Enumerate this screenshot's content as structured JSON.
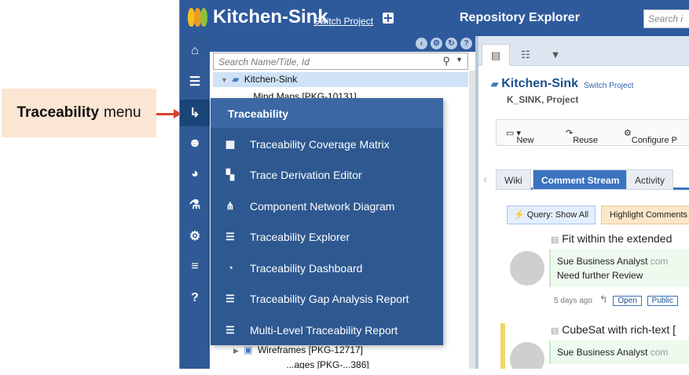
{
  "callout": {
    "bold": "Traceability",
    "text": "menu"
  },
  "topbar": {
    "project": "Kitchen-Sink",
    "switch_project": "Switch Project",
    "page_title": "Repository Explorer",
    "search_placeholder": "Search i"
  },
  "sidebar": {
    "items": [
      {
        "name": "home-icon",
        "glyph": "⌂"
      },
      {
        "name": "database-icon",
        "glyph": "☰"
      },
      {
        "name": "traceability-icon",
        "glyph": "↳"
      },
      {
        "name": "users-icon",
        "glyph": "☻"
      },
      {
        "name": "pie-chart-icon",
        "glyph": "◕"
      },
      {
        "name": "flask-icon",
        "glyph": "⚗"
      },
      {
        "name": "gear-icon",
        "glyph": "⚙"
      },
      {
        "name": "menu-icon",
        "glyph": "≡"
      },
      {
        "name": "help-icon",
        "glyph": "?"
      }
    ]
  },
  "tree": {
    "search_placeholder": "Search Name/Title, Id",
    "rows": [
      {
        "label": "Kitchen-Sink"
      },
      {
        "label": "Mind Maps [PKG-10131]"
      },
      {
        "label": "Wireframes [PKG-12717]"
      },
      {
        "label": "...ages [PKG-...386]"
      }
    ]
  },
  "trace_menu": {
    "title": "Traceability",
    "items": [
      {
        "label": "Traceability Coverage Matrix",
        "icon": "matrix-icon",
        "glyph": "▦"
      },
      {
        "label": "Trace Derivation Editor",
        "icon": "derivation-icon",
        "glyph": "▚"
      },
      {
        "label": "Component Network Diagram",
        "icon": "network-icon",
        "glyph": "⋔"
      },
      {
        "label": "Traceability Explorer",
        "icon": "explorer-icon",
        "glyph": "☰"
      },
      {
        "label": "Traceability Dashboard",
        "icon": "dashboard-icon",
        "glyph": "◔"
      },
      {
        "label": "Traceability Gap Analysis Report",
        "icon": "gap-report-icon",
        "glyph": "☰"
      },
      {
        "label": "Multi-Level Traceability Report",
        "icon": "multilevel-report-icon",
        "glyph": "☰"
      }
    ]
  },
  "right": {
    "title": "Kitchen-Sink",
    "switch_project": "Switch Project",
    "subtitle": "K_SINK, Project",
    "toolbar": {
      "new": "New",
      "reuse": "Reuse",
      "configure": "Configure P"
    },
    "tabs": [
      "Wiki",
      "Comment Stream",
      "Activity"
    ],
    "query_btn": "Query: Show All",
    "highlight_btn": "Highlight Comments",
    "posts": [
      {
        "title": "Fit within the extended",
        "author": "Sue Business Analyst",
        "suffix": "com",
        "body": "Need further Review",
        "meta": "5 days ago",
        "chips": [
          "Open",
          "Public"
        ]
      },
      {
        "title": "CubeSat with rich-text [",
        "author": "Sue Business Analyst",
        "suffix": "com"
      }
    ]
  }
}
